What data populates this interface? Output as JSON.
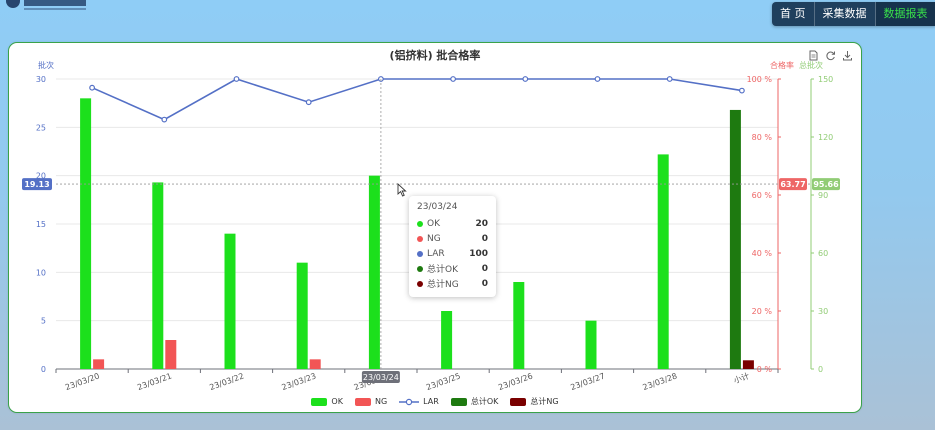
{
  "nav": {
    "items": [
      "首 页",
      "采集数据",
      "数据报表"
    ],
    "active_index": 2
  },
  "chart_data": {
    "type": "bar",
    "title": "(铝挤料) 批合格率",
    "categories": [
      "23/03/20",
      "23/03/21",
      "23/03/22",
      "23/03/23",
      "23/03/24",
      "23/03/25",
      "23/03/26",
      "23/03/27",
      "23/03/28",
      "小计"
    ],
    "series": [
      {
        "name": "OK",
        "type": "bar",
        "axis": "batches",
        "color": "#1ce01c",
        "values": [
          28,
          19.3,
          14,
          11,
          20,
          6,
          9,
          5,
          22.2,
          null
        ]
      },
      {
        "name": "NG",
        "type": "bar",
        "axis": "batches",
        "color": "#f25555",
        "values": [
          1,
          3,
          0,
          1,
          0,
          0,
          0,
          0,
          0,
          null
        ]
      },
      {
        "name": "LAR",
        "type": "line",
        "axis": "rate",
        "color": "#5470c6",
        "values": [
          97,
          86,
          100,
          92,
          100,
          100,
          100,
          100,
          100,
          96
        ]
      },
      {
        "name": "总计OK",
        "type": "bar",
        "axis": "batches",
        "color": "#1e7a10",
        "values": [
          null,
          null,
          null,
          null,
          null,
          null,
          null,
          null,
          null,
          134
        ]
      },
      {
        "name": "总计NG",
        "type": "bar",
        "axis": "batches",
        "color": "#7a0000",
        "values": [
          null,
          null,
          null,
          null,
          null,
          null,
          null,
          null,
          null,
          4.5
        ]
      }
    ],
    "axes": {
      "left": {
        "label": "批次",
        "color": "#5470c6",
        "range": [
          0,
          30
        ],
        "ticks": [
          0,
          5,
          10,
          15,
          20,
          25,
          30
        ]
      },
      "rate": {
        "label": "合格率",
        "color": "#ee6666",
        "range": [
          0,
          100
        ],
        "ticks": [
          0,
          20,
          40,
          60,
          80,
          100
        ],
        "unit": " %"
      },
      "total": {
        "label": "总批次",
        "color": "#91cc75",
        "range": [
          0,
          150
        ],
        "ticks": [
          0,
          30,
          60,
          90,
          120,
          150
        ]
      }
    },
    "crosshair": {
      "category": "23/03/24",
      "left_value": "19.13",
      "rate_value": "63.77",
      "total_value": "95.66"
    },
    "legend_position": "bottom-center"
  },
  "tooltip": {
    "title": "23/03/24",
    "rows": [
      {
        "name": "OK",
        "value": "20",
        "color": "#1ce01c"
      },
      {
        "name": "NG",
        "value": "0",
        "color": "#f25555"
      },
      {
        "name": "LAR",
        "value": "100",
        "color": "#5470c6"
      },
      {
        "name": "总计OK",
        "value": "0",
        "color": "#1e7a10"
      },
      {
        "name": "总计NG",
        "value": "0",
        "color": "#7a0000"
      }
    ]
  }
}
